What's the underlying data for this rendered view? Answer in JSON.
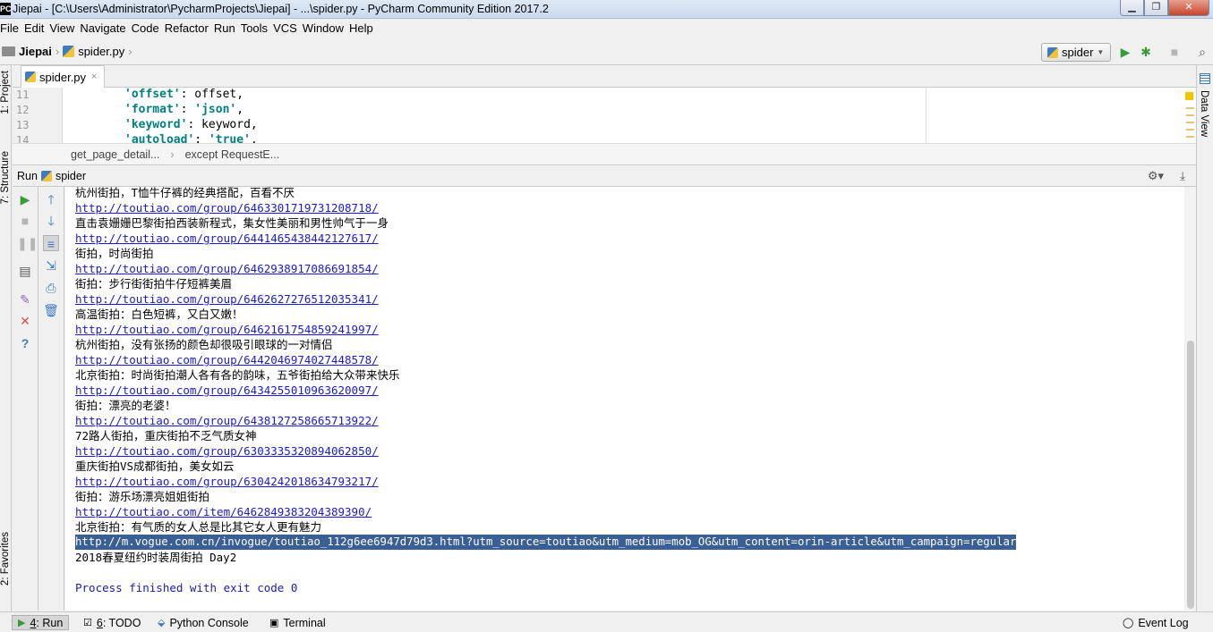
{
  "window": {
    "title": "Jiepai - [C:\\Users\\Administrator\\PycharmProjects\\Jiepai] - ...\\spider.py - PyCharm Community Edition 2017.2",
    "app_icon": "PC"
  },
  "menu": [
    "File",
    "Edit",
    "View",
    "Navigate",
    "Code",
    "Refactor",
    "Run",
    "Tools",
    "VCS",
    "Window",
    "Help"
  ],
  "navbar": {
    "project": "Jiepai",
    "file": "spider.py",
    "run_config": "spider"
  },
  "left_tabs": {
    "project": "1: Project",
    "structure": "7: Structure",
    "favorites": "2: Favorites"
  },
  "right_tabs": {
    "data_view": "Data View"
  },
  "editor": {
    "tab_label": "spider.py",
    "lines": [
      {
        "num": "11",
        "key": "'offset'",
        "rest": ": offset,"
      },
      {
        "num": "12",
        "key": "'format'",
        "rest": ": ",
        "val": "'json'",
        "tail": ","
      },
      {
        "num": "13",
        "key": "'keyword'",
        "rest": ": keyword,"
      },
      {
        "num": "14",
        "key": "'autoload'",
        "rest": ": ",
        "val": "'true'",
        "tail": ","
      }
    ],
    "breadcrumbs": [
      "get_page_detail...",
      "except RequestE..."
    ]
  },
  "run_panel": {
    "label": "Run",
    "config": "spider",
    "console": [
      {
        "type": "text",
        "text": "杭州街拍，T恤牛仔裤的经典搭配，百看不厌"
      },
      {
        "type": "link",
        "text": "http://toutiao.com/group/6463301719731208718/"
      },
      {
        "type": "text",
        "text": "直击袁姗姗巴黎街拍西装新程式，集女性美丽和男性帅气于一身"
      },
      {
        "type": "link",
        "text": "http://toutiao.com/group/6441465438442127617/"
      },
      {
        "type": "text",
        "text": "街拍，时尚街拍"
      },
      {
        "type": "link",
        "text": "http://toutiao.com/group/6462938917086691854/"
      },
      {
        "type": "text",
        "text": "街拍：步行街街拍牛仔短裤美眉"
      },
      {
        "type": "link",
        "text": "http://toutiao.com/group/6462627276512035341/"
      },
      {
        "type": "text",
        "text": "高温街拍：白色短裤，又白又嫩！"
      },
      {
        "type": "link",
        "text": "http://toutiao.com/group/6462161754859241997/"
      },
      {
        "type": "text",
        "text": "杭州街拍，没有张扬的颜色却很吸引眼球的一对情侣"
      },
      {
        "type": "link",
        "text": "http://toutiao.com/group/6442046974027448578/"
      },
      {
        "type": "text",
        "text": "北京街拍：时尚街拍潮人各有各的韵味，五爷街拍给大众带来快乐"
      },
      {
        "type": "link",
        "text": "http://toutiao.com/group/6434255010963620097/"
      },
      {
        "type": "text",
        "text": "街拍：漂亮的老婆！"
      },
      {
        "type": "link",
        "text": "http://toutiao.com/group/6438127258665713922/"
      },
      {
        "type": "text",
        "text": "72路人街拍，重庆街拍不乏气质女神"
      },
      {
        "type": "link",
        "text": "http://toutiao.com/group/6303335320894062850/"
      },
      {
        "type": "text",
        "text": "重庆街拍VS成都街拍，美女如云"
      },
      {
        "type": "link",
        "text": "http://toutiao.com/group/6304242018634793217/"
      },
      {
        "type": "text",
        "text": "街拍：游乐场漂亮姐姐街拍"
      },
      {
        "type": "link",
        "text": "http://toutiao.com/item/6462849383204389390/"
      },
      {
        "type": "text",
        "text": "北京街拍：有气质的女人总是比其它女人更有魅力"
      },
      {
        "type": "selected",
        "text": "http://m.vogue.com.cn/invogue/toutiao_112g6ee6947d79d3.html?utm_source=toutiao&utm_medium=mob_OG&utm_content=orin-article&utm_campaign=regular"
      },
      {
        "type": "text",
        "text": "2018春夏纽约时装周街拍 Day2"
      },
      {
        "type": "blank",
        "text": ""
      },
      {
        "type": "done",
        "text": "Process finished with exit code 0"
      }
    ]
  },
  "bottom_tabs": {
    "run_num": "4",
    "run": ": Run",
    "todo_num": "6",
    "todo": ": TODO",
    "python_console": "Python Console",
    "terminal": "Terminal",
    "event_log": "Event Log"
  },
  "colors": {
    "link": "#1a1ad6",
    "selection": "#3a5f95",
    "run_green": "#3a9a3a",
    "stop_red": "#d9534f"
  }
}
